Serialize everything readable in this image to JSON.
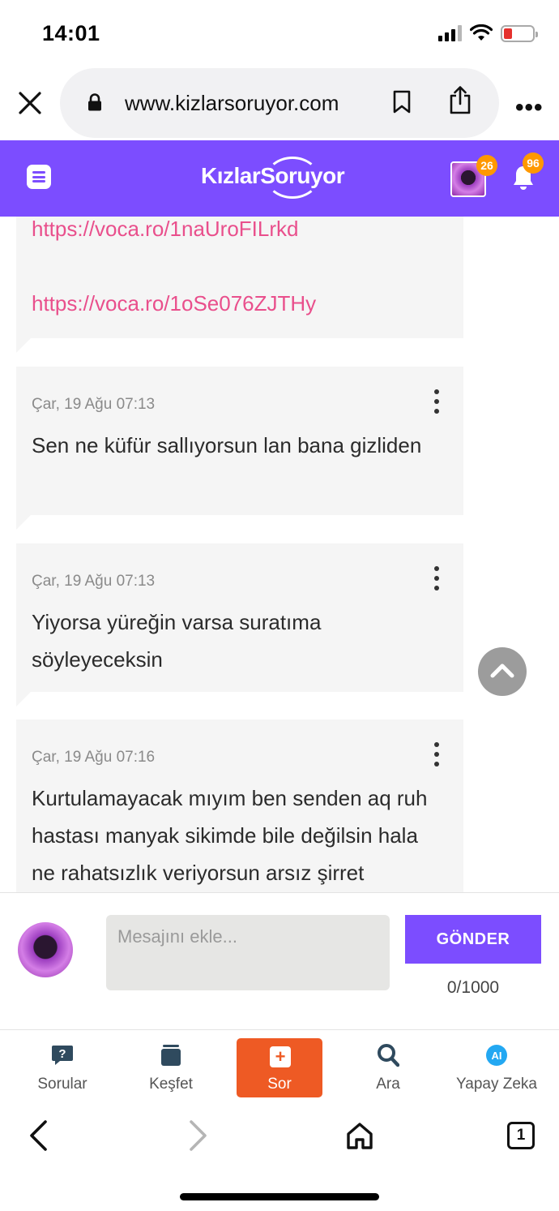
{
  "status_bar": {
    "time": "14:01",
    "battery_level": 0.12,
    "icons": [
      "cellular-signal-icon",
      "wifi-icon",
      "battery-icon"
    ]
  },
  "browser": {
    "url": "www.kizlarsoruyor.com",
    "icons": [
      "close-icon",
      "lock-icon",
      "bookmark-icon",
      "share-icon",
      "more-icon"
    ]
  },
  "site_header": {
    "logo_text_1": "Kızlar",
    "logo_text_2": "Soruyor",
    "avatar_badge": "26",
    "notification_badge": "96",
    "brand_color": "#7c4dff",
    "badge_color": "#ff9800"
  },
  "messages": {
    "links": [
      "https://voca.ro/1naUroFILrkd",
      "https://voca.ro/1oSe076ZJTHy"
    ],
    "items": [
      {
        "date": "Çar, 19 Ağu 07:13",
        "text": "Sen ne küfür sallıyorsun lan bana gizliden"
      },
      {
        "date": "Çar, 19 Ağu 07:13",
        "text": "Yiyorsa yüreğin varsa suratıma söyleyeceksin"
      },
      {
        "date": "Çar, 19 Ağu 07:16",
        "text": "Kurtulamayacak mıyım ben senden aq ruh hastası manyak sikimde bile değilsin hala ne rahatsızlık veriyorsun arsız şirret"
      }
    ]
  },
  "composer": {
    "placeholder": "Mesajını ekle...",
    "value": "",
    "send_label": "GÖNDER",
    "char_count": "0/1000"
  },
  "bottom_nav": {
    "items": [
      {
        "label": "Sorular",
        "icon": "question-bubble-icon"
      },
      {
        "label": "Keşfet",
        "icon": "stack-icon"
      },
      {
        "label": "Sor",
        "icon": "plus-square-icon"
      },
      {
        "label": "Ara",
        "icon": "search-icon"
      },
      {
        "label": "Yapay Zeka",
        "icon": "ai-icon"
      }
    ],
    "ask_color": "#ee5a24"
  },
  "safari_toolbar": {
    "tab_count": "1",
    "icons": [
      "back-icon",
      "forward-icon",
      "home-icon",
      "tabs-icon"
    ]
  }
}
